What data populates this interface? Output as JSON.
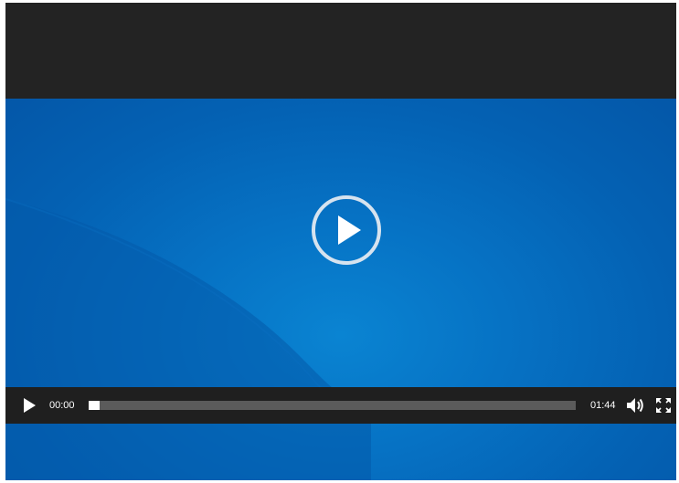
{
  "player": {
    "current_time": "00:00",
    "duration": "01:44",
    "progress_fraction": 0.022,
    "icons": {
      "big_play": "play-circle-icon",
      "play": "play-icon",
      "volume": "volume-icon",
      "fullscreen": "fullscreen-icon"
    },
    "colors": {
      "poster_blue": "#0672c4",
      "control_bar": "#1f1f1f",
      "top_band": "#232323",
      "progress_track": "#5b5b5b",
      "progress_fill": "#ffffff"
    }
  }
}
